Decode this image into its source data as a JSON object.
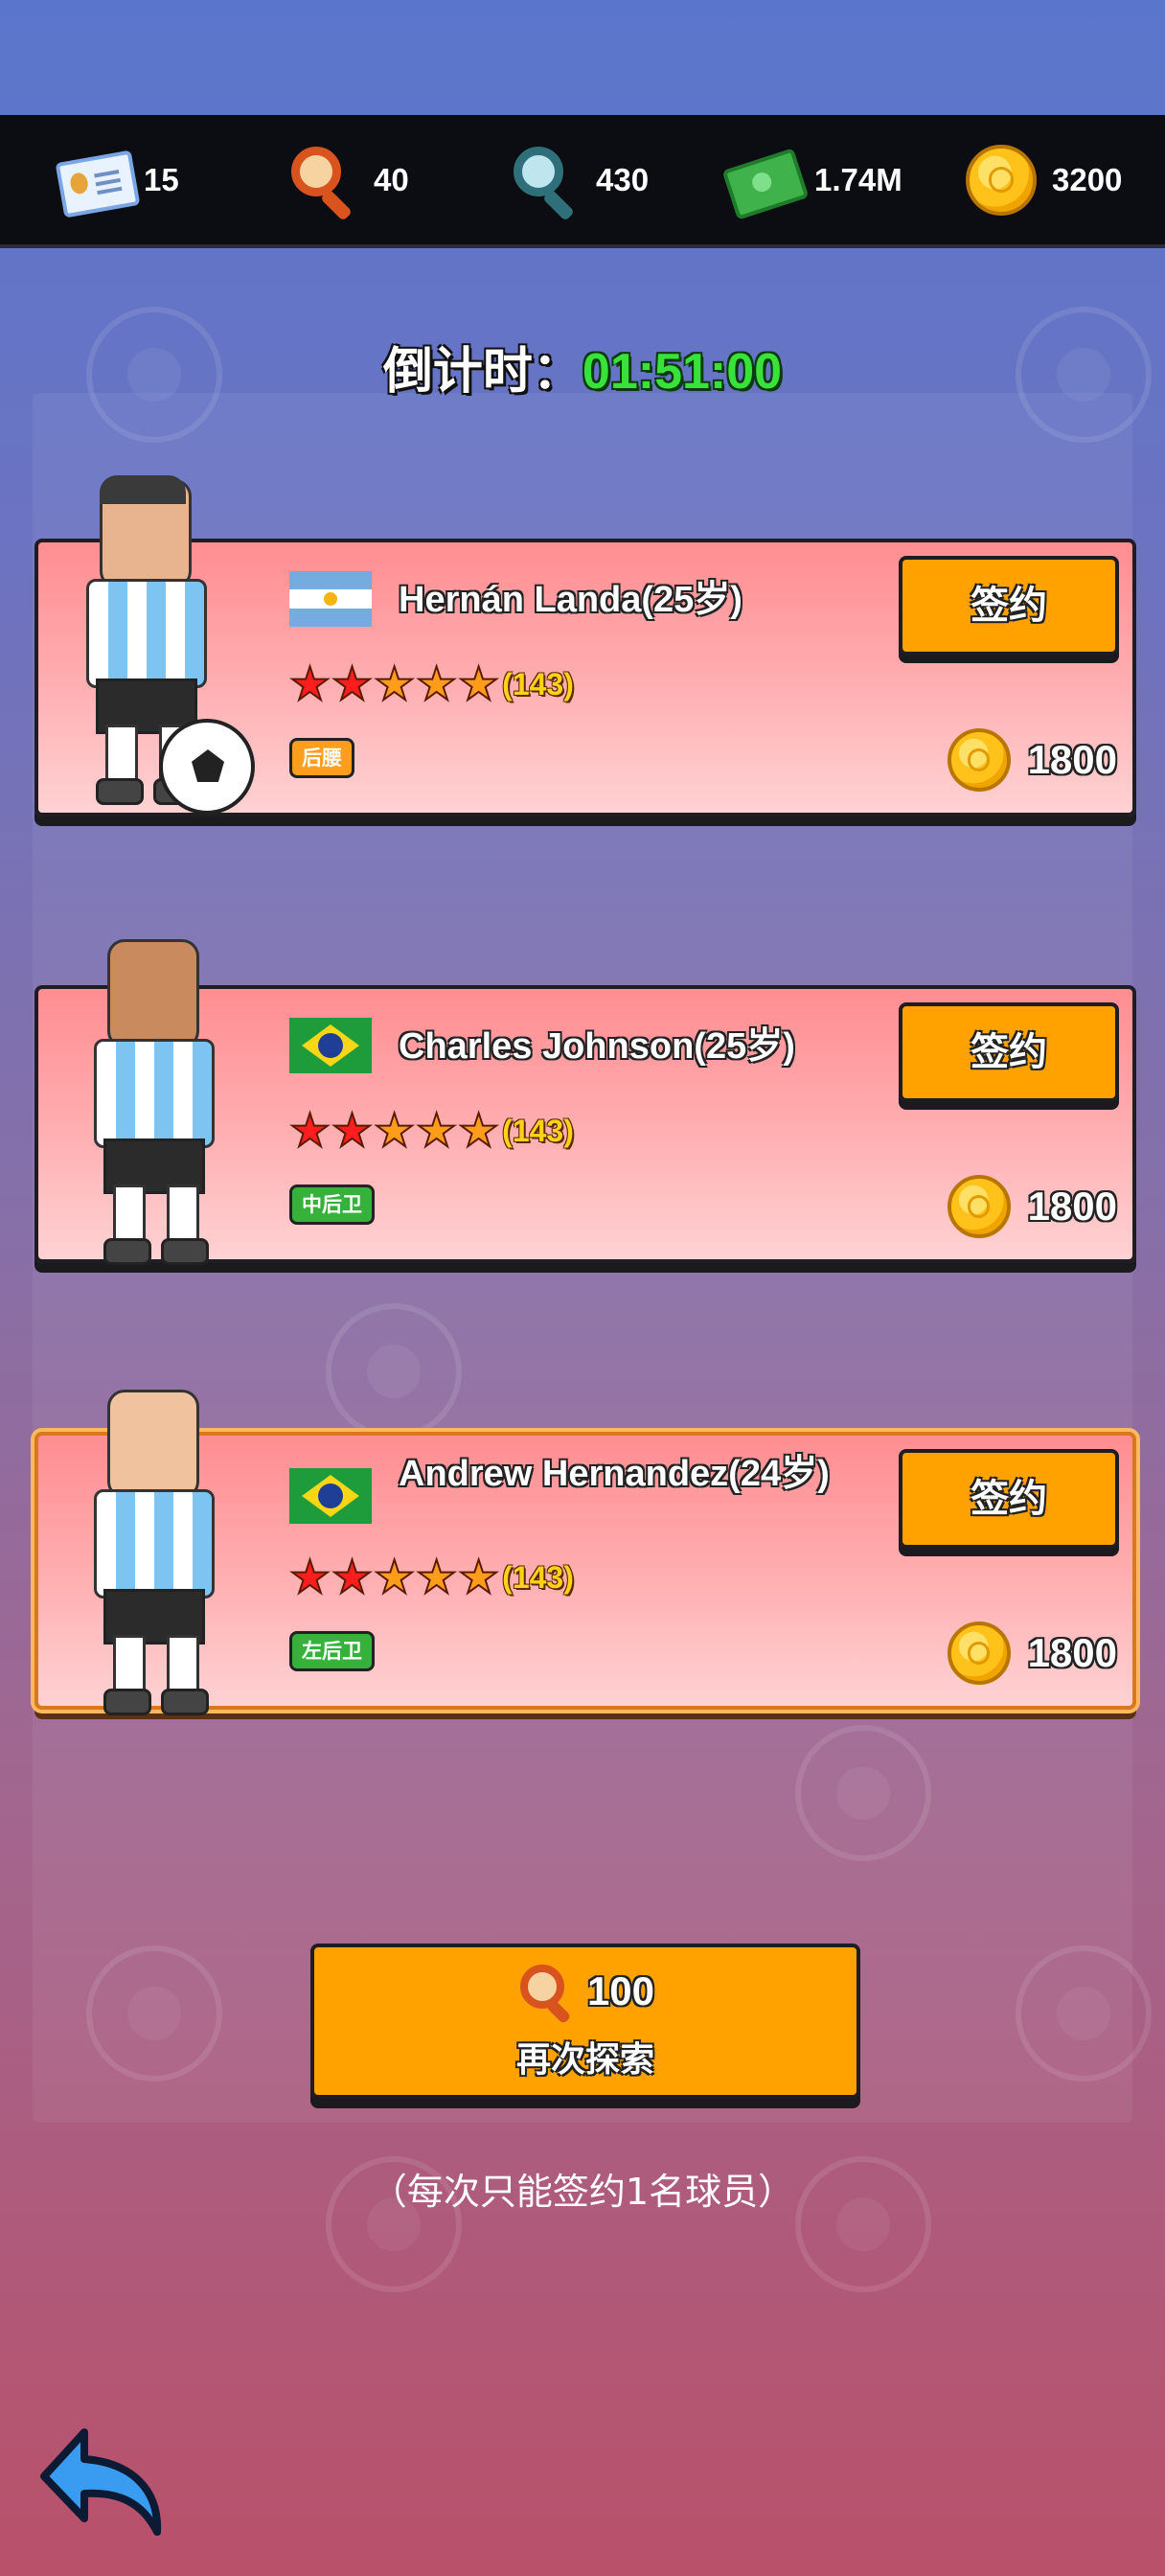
{
  "resources": [
    {
      "icon": "license-card-icon",
      "value": "15"
    },
    {
      "icon": "orange-magnifier-icon",
      "value": "40"
    },
    {
      "icon": "blue-magnifier-icon",
      "value": "430"
    },
    {
      "icon": "cash-icon",
      "value": "1.74M"
    },
    {
      "icon": "gold-coin-icon",
      "value": "3200"
    }
  ],
  "countdown": {
    "label": "倒计时：",
    "time": "01:51:00"
  },
  "players": [
    {
      "name": "Hernán Landa(25岁)",
      "flag": "argentina-flag-icon",
      "stars_filled": 2,
      "stars_total": 5,
      "rating": "(143)",
      "position": "后腰",
      "position_color": "#ff9d1d",
      "sign_label": "签约",
      "price": "1800",
      "selected": false
    },
    {
      "name": "Charles Johnson(25岁)",
      "flag": "brazil-flag-icon",
      "stars_filled": 2,
      "stars_total": 5,
      "rating": "(143)",
      "position": "中后卫",
      "position_color": "#36b23b",
      "sign_label": "签约",
      "price": "1800",
      "selected": false
    },
    {
      "name": "Andrew Hernandez(24岁)",
      "flag": "brazil-flag-icon",
      "stars_filled": 2,
      "stars_total": 5,
      "rating": "(143)",
      "position": "左后卫",
      "position_color": "#36b23b",
      "sign_label": "签约",
      "price": "1800",
      "selected": true
    }
  ],
  "explore": {
    "cost": "100",
    "label": "再次探索"
  },
  "note": "（每次只能签约1名球员）",
  "colors": {
    "button": "#ffa200",
    "countdown": "#38e23a",
    "star_filled": "#ff1d1d",
    "star_empty": "#ff9c1a"
  }
}
